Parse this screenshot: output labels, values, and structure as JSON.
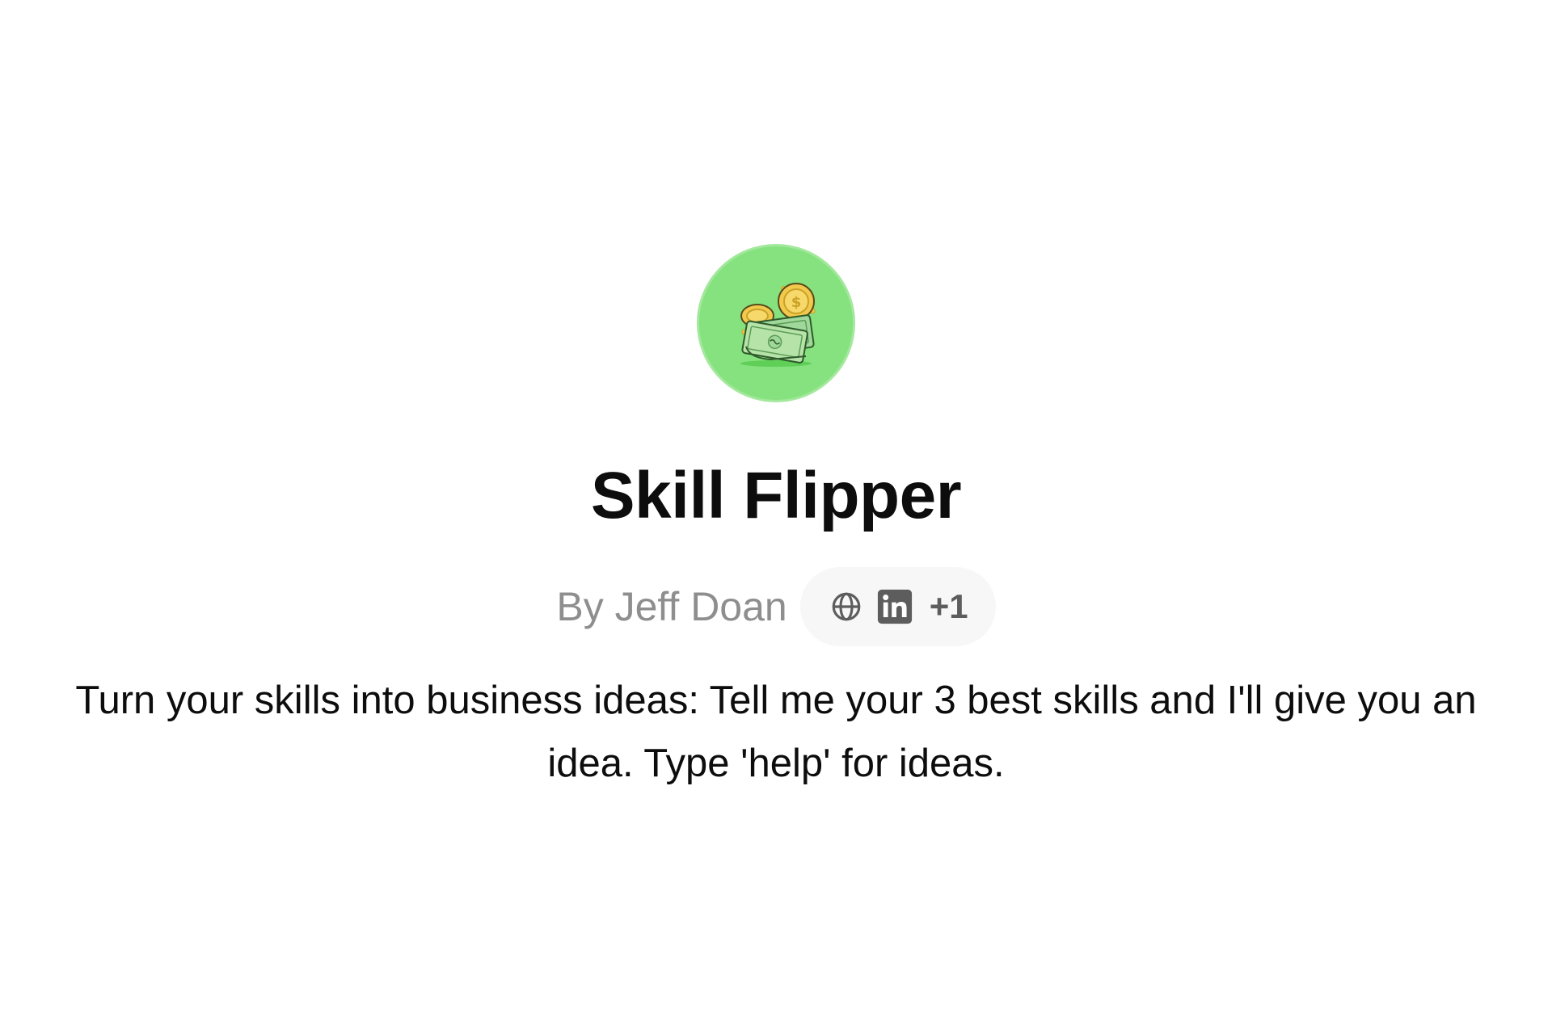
{
  "gpt": {
    "name": "Skill Flipper",
    "author": "By Jeff Doan",
    "links": {
      "globe_icon": "globe-icon",
      "linkedin_icon": "linkedin-icon",
      "more_count": "+1"
    },
    "description": "Turn your skills into business ideas: Tell me your 3 best skills and I'll give you an idea. Type 'help' for ideas."
  },
  "colors": {
    "avatar_bg": "#86e27f",
    "title_text": "#0d0d0d",
    "author_text": "#8e8e8e",
    "pill_bg": "#f7f7f7"
  }
}
